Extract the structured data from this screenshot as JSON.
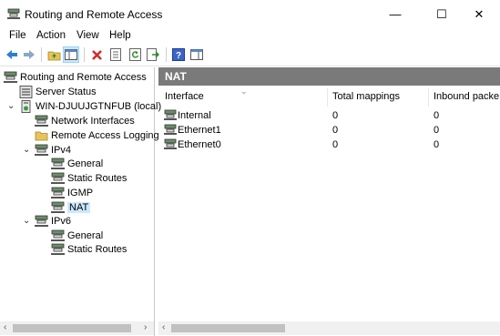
{
  "window": {
    "title": "Routing and Remote Access",
    "minimize": "—",
    "maximize": "☐",
    "close": "✕"
  },
  "menu": [
    "File",
    "Action",
    "View",
    "Help"
  ],
  "tree": {
    "root": "Routing and Remote Access",
    "server_status": "Server Status",
    "server": "WIN-DJUUJGTNFUB (local)",
    "network_interfaces": "Network Interfaces",
    "remote_access_logging": "Remote Access Logging",
    "ipv4": "IPv4",
    "ipv4_general": "General",
    "ipv4_static_routes": "Static Routes",
    "ipv4_igmp": "IGMP",
    "ipv4_nat": "NAT",
    "ipv6": "IPv6",
    "ipv6_general": "General",
    "ipv6_static_routes": "Static Routes"
  },
  "pane": {
    "title": "NAT",
    "columns": [
      "Interface",
      "Total mappings",
      "Inbound packe"
    ],
    "rows": [
      {
        "interface": "Internal",
        "total_mappings": "0",
        "inbound": "0"
      },
      {
        "interface": "Ethernet1",
        "total_mappings": "0",
        "inbound": "0"
      },
      {
        "interface": "Ethernet0",
        "total_mappings": "0",
        "inbound": "0"
      }
    ]
  },
  "colors": {
    "selection": "#cce8ff",
    "pane_header": "#7a7a7a",
    "back_arrow": "#2a7fd4"
  }
}
